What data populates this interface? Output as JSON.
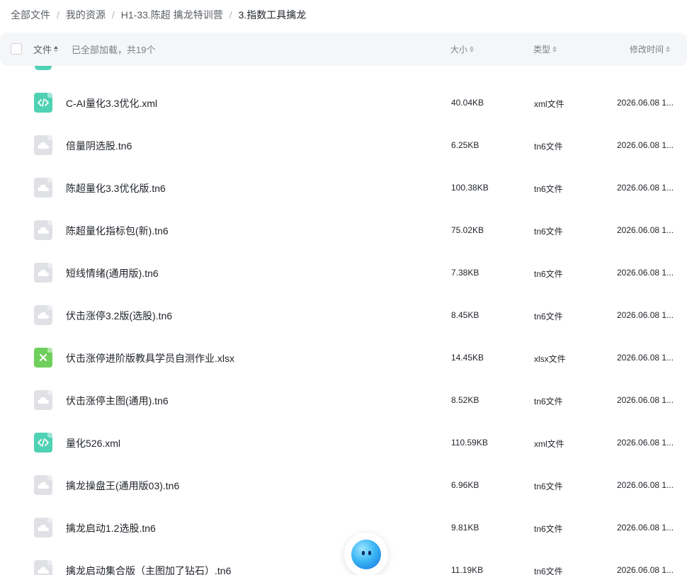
{
  "breadcrumb": [
    "全部文件",
    "我的资源",
    "H1-33.陈超 擒龙特训营",
    "3.指数工具擒龙"
  ],
  "header": {
    "name": "文件",
    "status": "已全部加载，共19个",
    "size": "大小",
    "type": "类型",
    "mtime": "修改时间"
  },
  "files": [
    {
      "name": "C-AI量化3.3优化.xml",
      "size": "40.04KB",
      "type": "xml文件",
      "mtime": "2026.06.08 1...",
      "icon": "xml-file-icon"
    },
    {
      "name": "倍量阴选股.tn6",
      "size": "6.25KB",
      "type": "tn6文件",
      "mtime": "2026.06.08 1...",
      "icon": "cloud-file-icon"
    },
    {
      "name": "陈超量化3.3优化版.tn6",
      "size": "100.38KB",
      "type": "tn6文件",
      "mtime": "2026.06.08 1...",
      "icon": "cloud-file-icon"
    },
    {
      "name": "陈超量化指标包(新).tn6",
      "size": "75.02KB",
      "type": "tn6文件",
      "mtime": "2026.06.08 1...",
      "icon": "cloud-file-icon"
    },
    {
      "name": "短线情绪(通用版).tn6",
      "size": "7.38KB",
      "type": "tn6文件",
      "mtime": "2026.06.08 1...",
      "icon": "cloud-file-icon"
    },
    {
      "name": "伏击涨停3.2版(选股).tn6",
      "size": "8.45KB",
      "type": "tn6文件",
      "mtime": "2026.06.08 1...",
      "icon": "cloud-file-icon"
    },
    {
      "name": "伏击涨停进阶版教具学员自测作业.xlsx",
      "size": "14.45KB",
      "type": "xlsx文件",
      "mtime": "2026.06.08 1...",
      "icon": "excel-file-icon"
    },
    {
      "name": "伏击涨停主图(通用).tn6",
      "size": "8.52KB",
      "type": "tn6文件",
      "mtime": "2026.06.08 1...",
      "icon": "cloud-file-icon"
    },
    {
      "name": "量化526.xml",
      "size": "110.59KB",
      "type": "xml文件",
      "mtime": "2026.06.08 1...",
      "icon": "xml-file-icon"
    },
    {
      "name": "擒龙操盘王(通用版03).tn6",
      "size": "6.96KB",
      "type": "tn6文件",
      "mtime": "2026.06.08 1...",
      "icon": "cloud-file-icon"
    },
    {
      "name": "擒龙启动1.2选股.tn6",
      "size": "9.81KB",
      "type": "tn6文件",
      "mtime": "2026.06.08 1...",
      "icon": "cloud-file-icon"
    },
    {
      "name": "擒龙启动集合版（主图加了钻石）.tn6",
      "size": "11.19KB",
      "type": "tn6文件",
      "mtime": "2026.06.08 1...",
      "icon": "cloud-file-icon"
    }
  ]
}
